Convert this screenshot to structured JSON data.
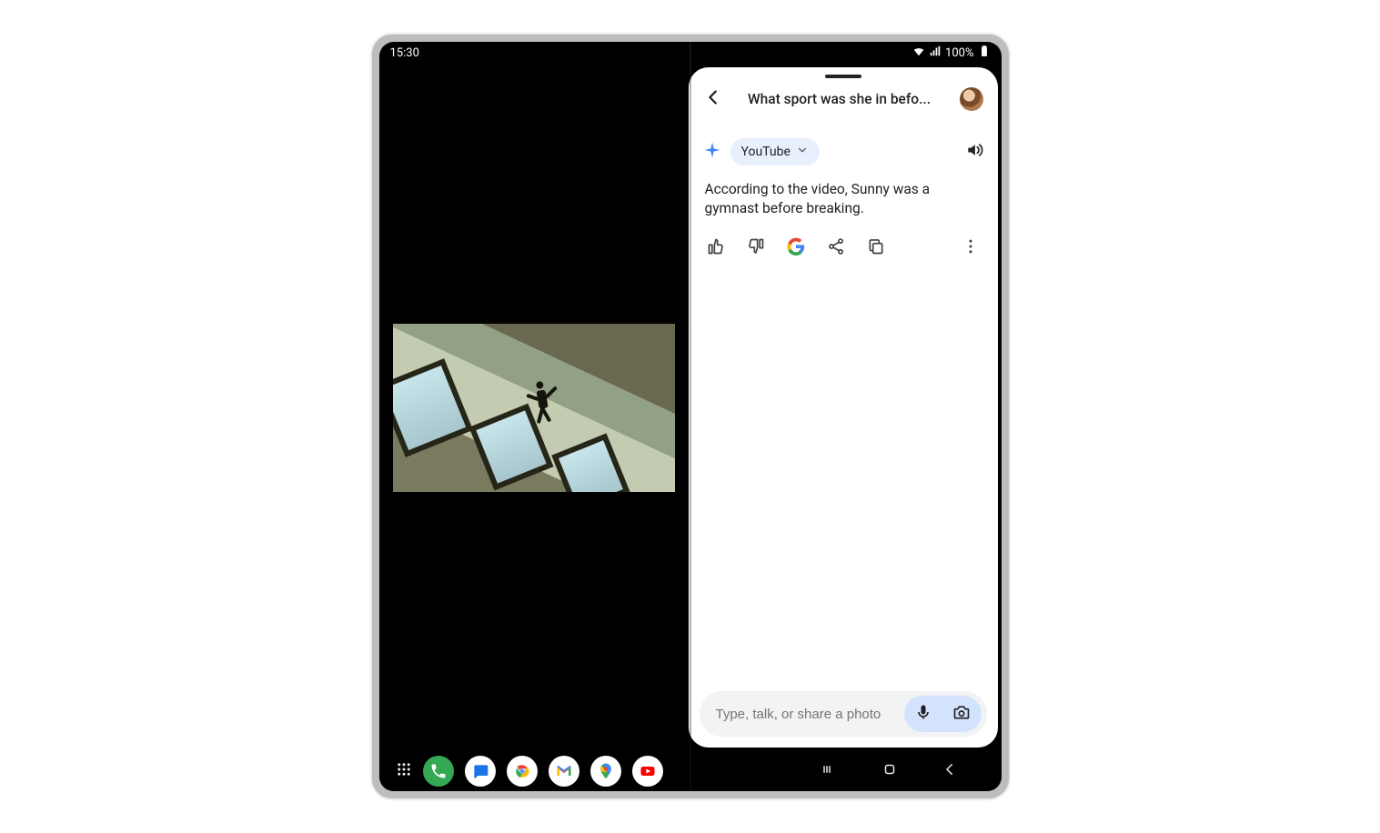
{
  "status": {
    "time": "15:30",
    "battery": "100%"
  },
  "panel": {
    "title": "What sport was she in befo...",
    "source_label": "YouTube",
    "answer": "According to the video, Sunny was a gymnast before breaking."
  },
  "input": {
    "placeholder": "Type, talk, or share a photo"
  }
}
